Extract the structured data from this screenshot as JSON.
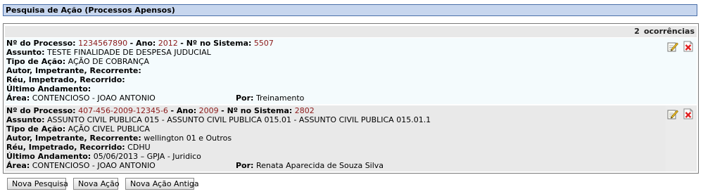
{
  "header": {
    "title": "Pesquisa de Ação (Processos Apensos)"
  },
  "results": {
    "count": "2",
    "count_label": "ocorrências",
    "labels": {
      "processo": "Nº do Processo:",
      "ano": "Ano:",
      "sistema": "Nº no Sistema:",
      "assunto": "Assunto:",
      "tipo_acao": "Tipo de Ação:",
      "autor": "Autor, Impetrante, Recorrente:",
      "reu": "Réu, Impetrado, Recorrido:",
      "ultimo_andamento": "Último Andamento:",
      "area": "Área:",
      "por": "Por:"
    },
    "records": [
      {
        "processo": "1234567890",
        "ano": "2012",
        "sistema": "5507",
        "assunto": "TESTE FINALIDADE DE DESPESA JUDUCIAL",
        "tipo_acao": "AÇÃO DE COBRANÇA",
        "autor": "",
        "reu": "",
        "ultimo_andamento": "",
        "area": "CONTENCIOSO - JOAO ANTONIO",
        "por": "Treinamento"
      },
      {
        "processo": "407-456-2009-12345-6",
        "ano": "2009",
        "sistema": "2802",
        "assunto": "ASSUNTO CIVIL PUBLICA 015 - ASSUNTO CIVIL PUBLICA 015.01 - ASSUNTO CIVIL PUBLICA 015.01.1",
        "tipo_acao": "AÇÃO CIVEL PUBLICA",
        "autor": "wellington 01 e Outros",
        "reu": "CDHU",
        "ultimo_andamento": "05/06/2013 – GPJA - Juridico",
        "area": "CONTENCIOSO - JOAO ANTONIO",
        "por": "Renata Aparecida de Souza Silva"
      }
    ]
  },
  "buttons": {
    "nova_pesquisa": "Nova Pesquisa",
    "nova_acao": "Nova Ação",
    "nova_acao_antiga": "Nova Ação Antiga"
  },
  "icons": {
    "edit": "edit-pencil-icon",
    "delete": "delete-x-icon"
  },
  "colors": {
    "header_bg": "#c7d6ee",
    "header_border": "#4a6fa8",
    "value_red": "#8b1a1a",
    "delete_red": "#e02020"
  }
}
